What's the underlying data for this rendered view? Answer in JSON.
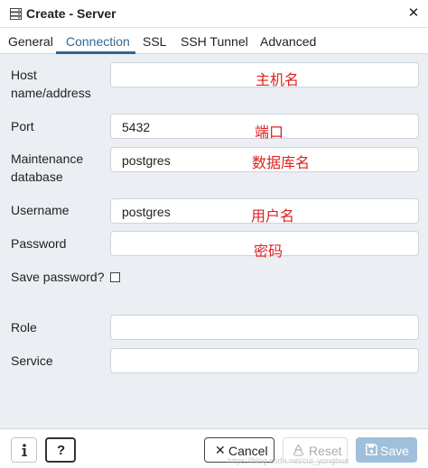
{
  "titlebar": {
    "title": "Create - Server",
    "icon": "server-icon",
    "close_glyph": "✕"
  },
  "tabs": [
    {
      "label": "General",
      "active": false
    },
    {
      "label": "Connection",
      "active": true
    },
    {
      "label": "SSL",
      "active": false
    },
    {
      "label": "SSH Tunnel",
      "active": false
    },
    {
      "label": "Advanced",
      "active": false
    }
  ],
  "form": {
    "host": {
      "label": "Host name/address",
      "value": "",
      "annotation": "主机名"
    },
    "port": {
      "label": "Port",
      "value": "5432",
      "annotation": "端口"
    },
    "maintenance_db": {
      "label": "Maintenance database",
      "value": "postgres",
      "annotation": "数据库名"
    },
    "username": {
      "label": "Username",
      "value": "postgres",
      "annotation": "用户名"
    },
    "password": {
      "label": "Password",
      "value": "",
      "annotation": "密码"
    },
    "save_password": {
      "label": "Save password?",
      "checked": false
    },
    "role": {
      "label": "Role",
      "value": ""
    },
    "service": {
      "label": "Service",
      "value": ""
    }
  },
  "footer": {
    "info_icon": "info-icon",
    "help_label": "?",
    "cancel_label": "Cancel",
    "reset_label": "Reset",
    "save_label": "Save"
  },
  "watermark": "https://blog.csdn.net/cui_yonghua",
  "colors": {
    "accent": "#326690",
    "annotation": "#e02020",
    "panel_bg": "#ebeef3",
    "save_bg": "#9fbfdb"
  }
}
